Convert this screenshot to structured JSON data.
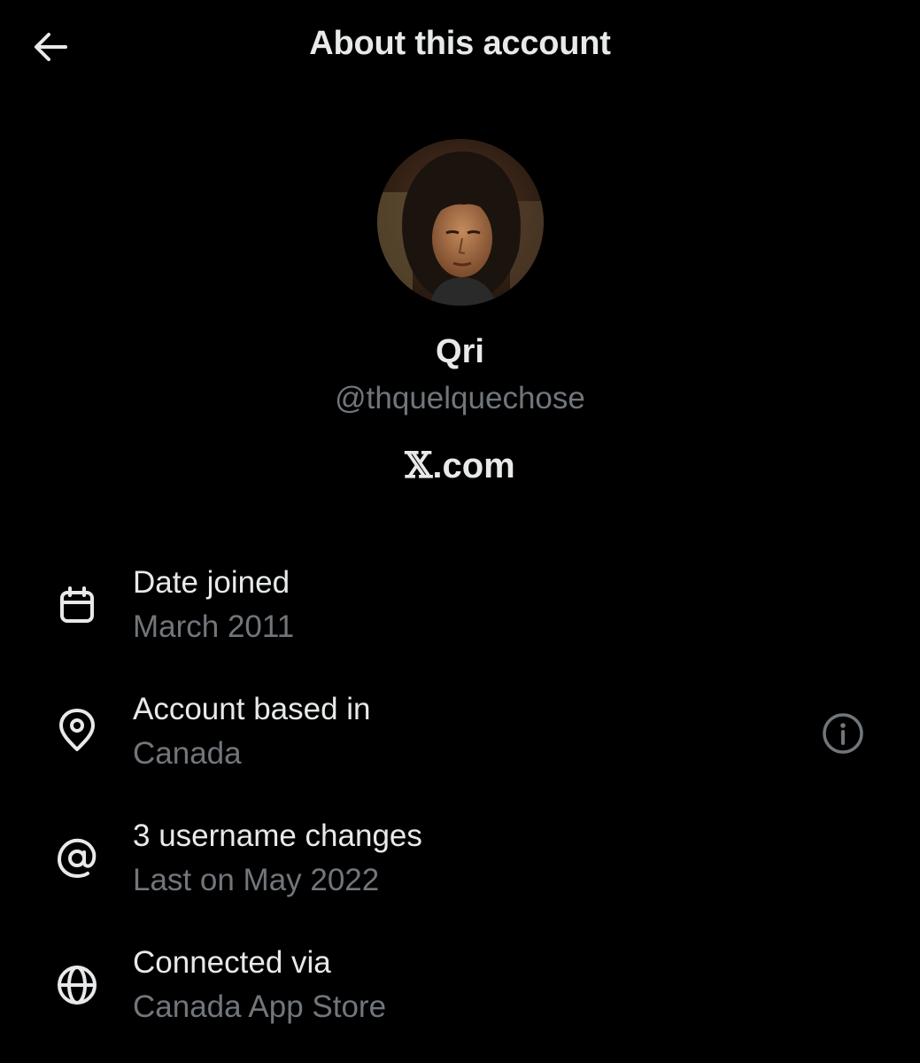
{
  "header": {
    "title": "About this account",
    "back_icon": "arrow-left-icon"
  },
  "profile": {
    "display_name": "Qri",
    "handle": "@thquelquechose",
    "avatar_icon": "profile-photo-avatar"
  },
  "brand": {
    "mark": "𝕏",
    "suffix": ".com"
  },
  "info_rows": [
    {
      "icon": "calendar-icon",
      "label": "Date joined",
      "value": "March 2011"
    },
    {
      "icon": "location-pin-icon",
      "label": "Account based in",
      "value": "Canada",
      "action_icon": "info-icon"
    },
    {
      "icon": "at-sign-icon",
      "label": "3 username changes",
      "value": "Last on May 2022"
    },
    {
      "icon": "globe-icon",
      "label": "Connected via",
      "value": "Canada App Store"
    }
  ],
  "colors": {
    "background": "#000000",
    "primary_text": "#e7e9ea",
    "secondary_text": "#71767b"
  }
}
